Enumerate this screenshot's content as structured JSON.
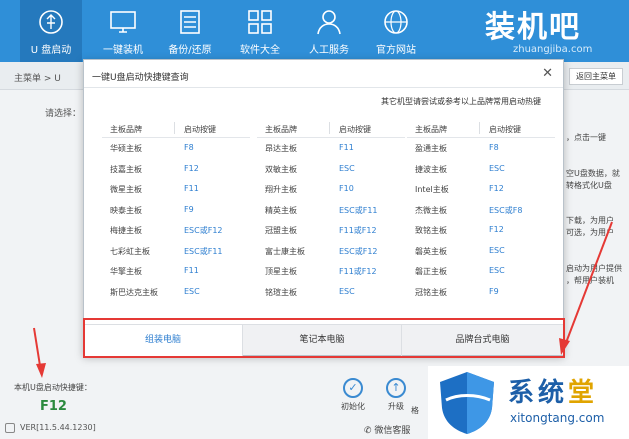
{
  "nav": [
    {
      "label": "U 盘启动",
      "icon": "usb-icon",
      "active": true
    },
    {
      "label": "一键装机",
      "icon": "monitor-icon"
    },
    {
      "label": "备份/还原",
      "icon": "backup-icon"
    },
    {
      "label": "软件大全",
      "icon": "apps-grid-icon"
    },
    {
      "label": "人工服务",
      "icon": "person-icon"
    },
    {
      "label": "官方网站",
      "icon": "globe-icon"
    }
  ],
  "brand": {
    "name": "装机吧",
    "url": "zhuangjiba.com"
  },
  "subbar": {
    "crumb": "主菜单 > U",
    "back": "返回主菜单"
  },
  "main": {
    "please_select": "请选择：",
    "side_texts": [
      "，点击一键",
      "空U盘数据，就",
      "转格式化U盘",
      "下载，为用户",
      "可选，为用户",
      "启动为用户提供",
      "，帮用户装机"
    ],
    "hotkey_label": "本机U盘启动快捷键：",
    "hotkey_value": "F12",
    "version": "VER[11.5.44.1230]",
    "actions": [
      "初始化",
      "升级",
      "格"
    ],
    "wechat": "微信客服"
  },
  "modal": {
    "title": "一键U盘启动快捷键查询",
    "hint": "其它机型请尝试或参考以上品牌常用启动热键",
    "header_brand": "主板品牌",
    "header_key": "启动按键",
    "columns": [
      [
        {
          "brand": "华硕主板",
          "key": "F8"
        },
        {
          "brand": "技嘉主板",
          "key": "F12"
        },
        {
          "brand": "微星主板",
          "key": "F11"
        },
        {
          "brand": "映泰主板",
          "key": "F9"
        },
        {
          "brand": "梅捷主板",
          "key": "ESC或F12"
        },
        {
          "brand": "七彩虹主板",
          "key": "ESC或F11"
        },
        {
          "brand": "华擎主板",
          "key": "F11"
        },
        {
          "brand": "斯巴达克主板",
          "key": "ESC"
        }
      ],
      [
        {
          "brand": "昂达主板",
          "key": "F11"
        },
        {
          "brand": "双敏主板",
          "key": "ESC"
        },
        {
          "brand": "翔升主板",
          "key": "F10"
        },
        {
          "brand": "精英主板",
          "key": "ESC或F11"
        },
        {
          "brand": "冠盟主板",
          "key": "F11或F12"
        },
        {
          "brand": "富士康主板",
          "key": "ESC或F12"
        },
        {
          "brand": "顶星主板",
          "key": "F11或F12"
        },
        {
          "brand": "铭瑄主板",
          "key": "ESC"
        }
      ],
      [
        {
          "brand": "盈通主板",
          "key": "F8"
        },
        {
          "brand": "捷波主板",
          "key": "ESC"
        },
        {
          "brand": "Intel主板",
          "key": "F12"
        },
        {
          "brand": "杰微主板",
          "key": "ESC或F8"
        },
        {
          "brand": "致铭主板",
          "key": "F12"
        },
        {
          "brand": "磐英主板",
          "key": "ESC"
        },
        {
          "brand": "磐正主板",
          "key": "ESC"
        },
        {
          "brand": "冠铭主板",
          "key": "F9"
        }
      ]
    ],
    "tabs": [
      "组装电脑",
      "笔记本电脑",
      "品牌台式电脑"
    ]
  },
  "watermark": {
    "title_a": "系统",
    "title_b": "堂",
    "url": "xitongtang.com"
  },
  "colors": {
    "topbar": "#2f8fd8",
    "accent": "#2f7fd0",
    "highlight": "#e53935",
    "hotkey": "#2b8a3e"
  }
}
